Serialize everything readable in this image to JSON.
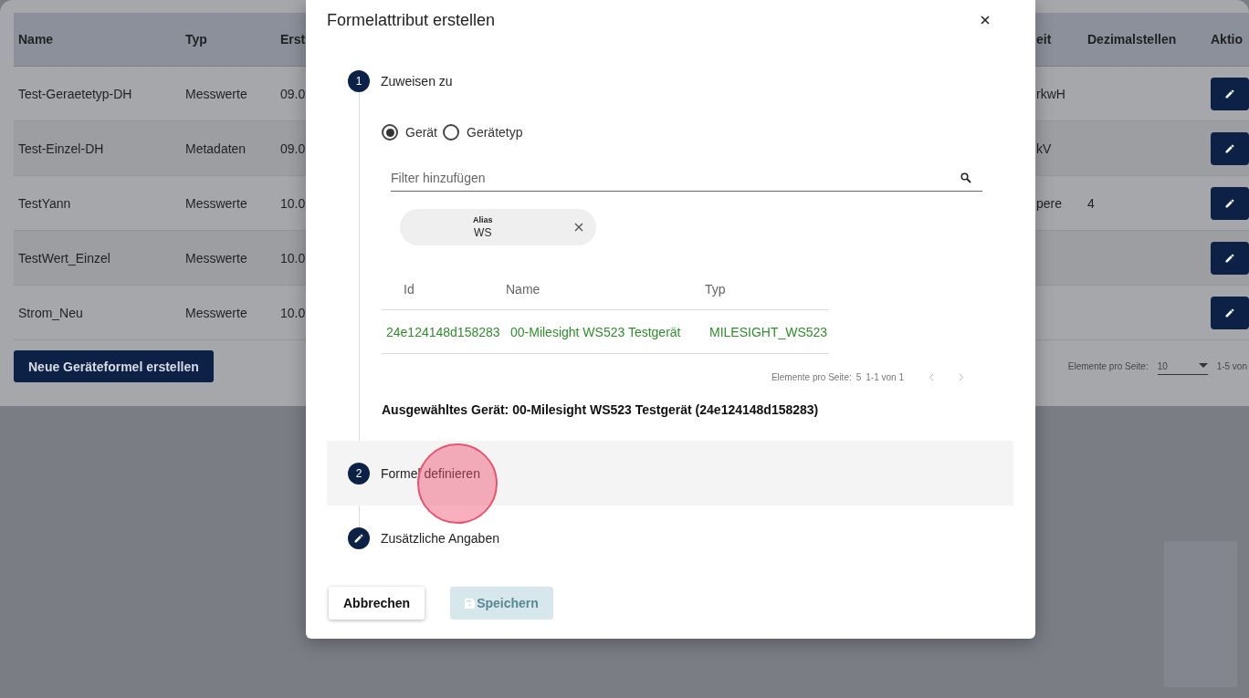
{
  "table": {
    "columns": [
      "Name",
      "Typ",
      "Erst",
      "eit",
      "Dezimalstellen",
      "Aktio"
    ],
    "rows": [
      {
        "cells": [
          "Test-Geraetetyp-DH",
          "Messwerte",
          "09.0",
          "rkwH",
          ""
        ]
      },
      {
        "cells": [
          "Test-Einzel-DH",
          "Metadaten",
          "09.0",
          "kV",
          ""
        ]
      },
      {
        "cells": [
          "TestYann",
          "Messwerte",
          "10.0",
          "pere",
          "4"
        ]
      },
      {
        "cells": [
          "TestWert_Einzel",
          "Messwerte",
          "10.0",
          "",
          ""
        ]
      },
      {
        "cells": [
          "Strom_Neu",
          "Messwerte",
          "10.0",
          "",
          ""
        ]
      }
    ],
    "create_button": "Neue Geräteformel erstellen",
    "paginator": {
      "label": "Elemente pro Seite:",
      "page_size": "10",
      "range": "1-5 von"
    }
  },
  "dialog": {
    "title": "Formelattribut erstellen",
    "steps": [
      {
        "kind": "number",
        "number": "1",
        "label": "Zuweisen zu",
        "highlighted": false
      },
      {
        "kind": "number",
        "number": "2",
        "label": "Formel definieren",
        "highlighted": true
      },
      {
        "kind": "edit",
        "label": "Zusätzliche Angaben",
        "highlighted": false
      }
    ],
    "assign": {
      "options": [
        {
          "label": "Gerät",
          "selected": true
        },
        {
          "label": "Gerätetyp",
          "selected": false
        }
      ],
      "filter": {
        "placeholder": "Filter hinzufügen"
      },
      "chips": [
        {
          "key": "Alias",
          "value": "WS"
        }
      ],
      "columns": [
        "Id",
        "Name",
        "Typ"
      ],
      "rows": [
        {
          "cells": [
            "24e124148d158283",
            "00-Milesight WS523 Testgerät",
            "MILESIGHT_WS523"
          ]
        }
      ],
      "paginator": {
        "label": "Elemente pro Seite:",
        "page_size": "5",
        "range": "1-1 von 1"
      },
      "selection": "Ausgewähltes Gerät: 00-Milesight WS523 Testgerät (24e124148d158283)"
    },
    "buttons": [
      {
        "label": "Abbrechen",
        "disabled": false
      },
      {
        "label": "Speichern",
        "disabled": true
      }
    ]
  }
}
